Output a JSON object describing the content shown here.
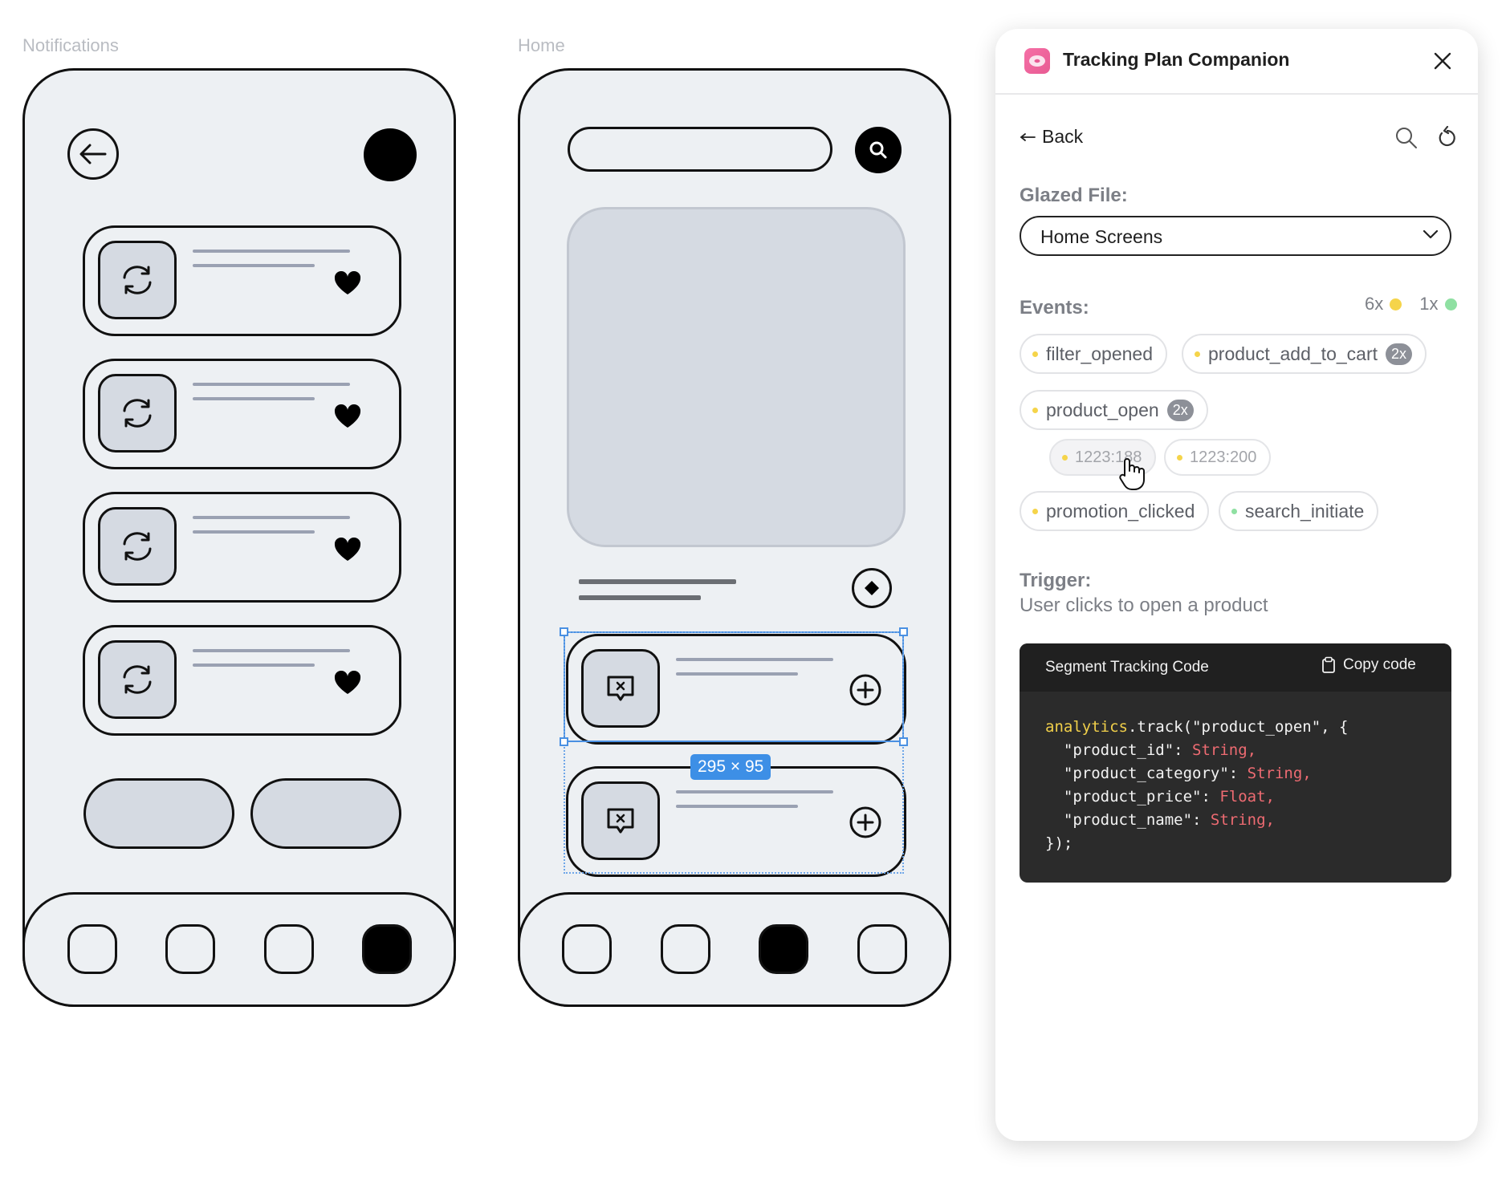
{
  "frames": {
    "notifications": {
      "label": "Notifications"
    },
    "home": {
      "label": "Home"
    }
  },
  "selection": {
    "size_label": "295 × 95"
  },
  "panel": {
    "title": "Tracking Plan Companion",
    "back_label": "Back",
    "file_section_label": "Glazed File:",
    "file_selected": "Home Screens",
    "events_label": "Events:",
    "legend": [
      {
        "count": "6x",
        "color": "#f5d44a"
      },
      {
        "count": "1x",
        "color": "#8fe0a2"
      }
    ],
    "events": [
      {
        "name": "filter_opened",
        "dot": "#f5d44a",
        "count": ""
      },
      {
        "name": "product_add_to_cart",
        "dot": "#f5d44a",
        "count": "2x"
      },
      {
        "name": "product_open",
        "dot": "#f5d44a",
        "count": "2x"
      },
      {
        "name": "promotion_clicked",
        "dot": "#f5d44a",
        "count": ""
      },
      {
        "name": "search_initiate",
        "dot": "#8fe0a2",
        "count": ""
      }
    ],
    "sub_nodes": [
      "1223:188",
      "1223:200"
    ],
    "trigger_label": "Trigger:",
    "trigger_text": "User clicks to open a product",
    "code_block": {
      "title": "Segment Tracking Code",
      "copy_label": "Copy code",
      "lines": [
        {
          "a": "analytics",
          "b": ".track(\"product_open\", {",
          "c": ""
        },
        {
          "a": "",
          "b": "  \"product_id\": ",
          "c": "String,"
        },
        {
          "a": "",
          "b": "  \"product_category\": ",
          "c": "String,"
        },
        {
          "a": "",
          "b": "  \"product_price\": ",
          "c": "Float,"
        },
        {
          "a": "",
          "b": "  \"product_name\": ",
          "c": "String,"
        },
        {
          "a": "",
          "b": "});",
          "c": ""
        }
      ]
    }
  },
  "icons": {
    "app_logo": "donut-icon",
    "close": "close-icon",
    "back": "arrow-left-icon",
    "search": "search-icon",
    "refresh": "refresh-icon",
    "dropdown": "chevron-down-icon",
    "copy": "clipboard-icon",
    "cursor": "hand-pointer-icon"
  }
}
